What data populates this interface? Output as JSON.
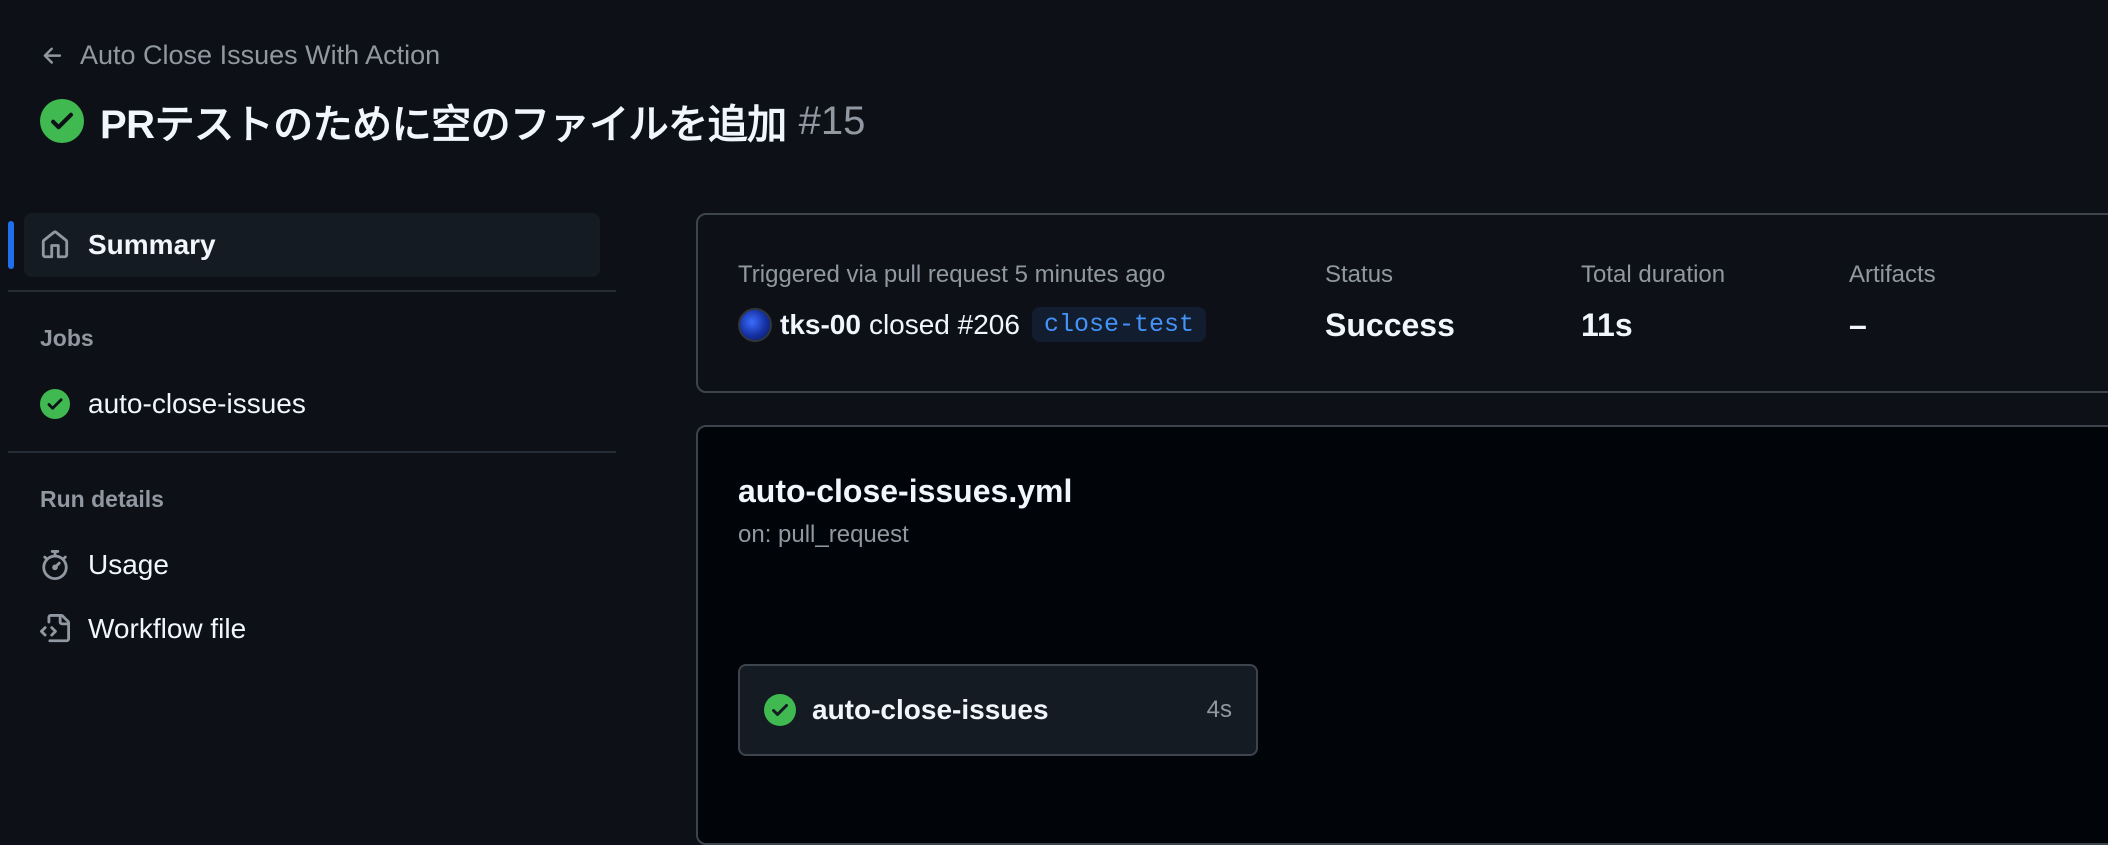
{
  "header": {
    "back_label": "Auto Close Issues With Action",
    "title": "PRテストのために空のファイルを追加",
    "run_number": "#15"
  },
  "sidebar": {
    "summary_label": "Summary",
    "jobs_heading": "Jobs",
    "jobs": [
      {
        "label": "auto-close-issues",
        "status": "success"
      }
    ],
    "run_details_heading": "Run details",
    "run_details": [
      {
        "label": "Usage",
        "icon": "stopwatch-icon"
      },
      {
        "label": "Workflow file",
        "icon": "file-code-icon"
      }
    ]
  },
  "summary": {
    "trigger_label": "Triggered via pull request 5 minutes ago",
    "actor": "tks-00",
    "action_text": "closed #206",
    "branch": "close-test",
    "status_label": "Status",
    "status_value": "Success",
    "duration_label": "Total duration",
    "duration_value": "11s",
    "artifacts_label": "Artifacts",
    "artifacts_value": "–"
  },
  "workflow": {
    "file_name": "auto-close-issues.yml",
    "trigger": "on: pull_request",
    "job": {
      "name": "auto-close-issues",
      "duration": "4s"
    }
  },
  "colors": {
    "success": "#3fb950",
    "accent": "#1f6feb",
    "branch_text": "#4493f8"
  }
}
